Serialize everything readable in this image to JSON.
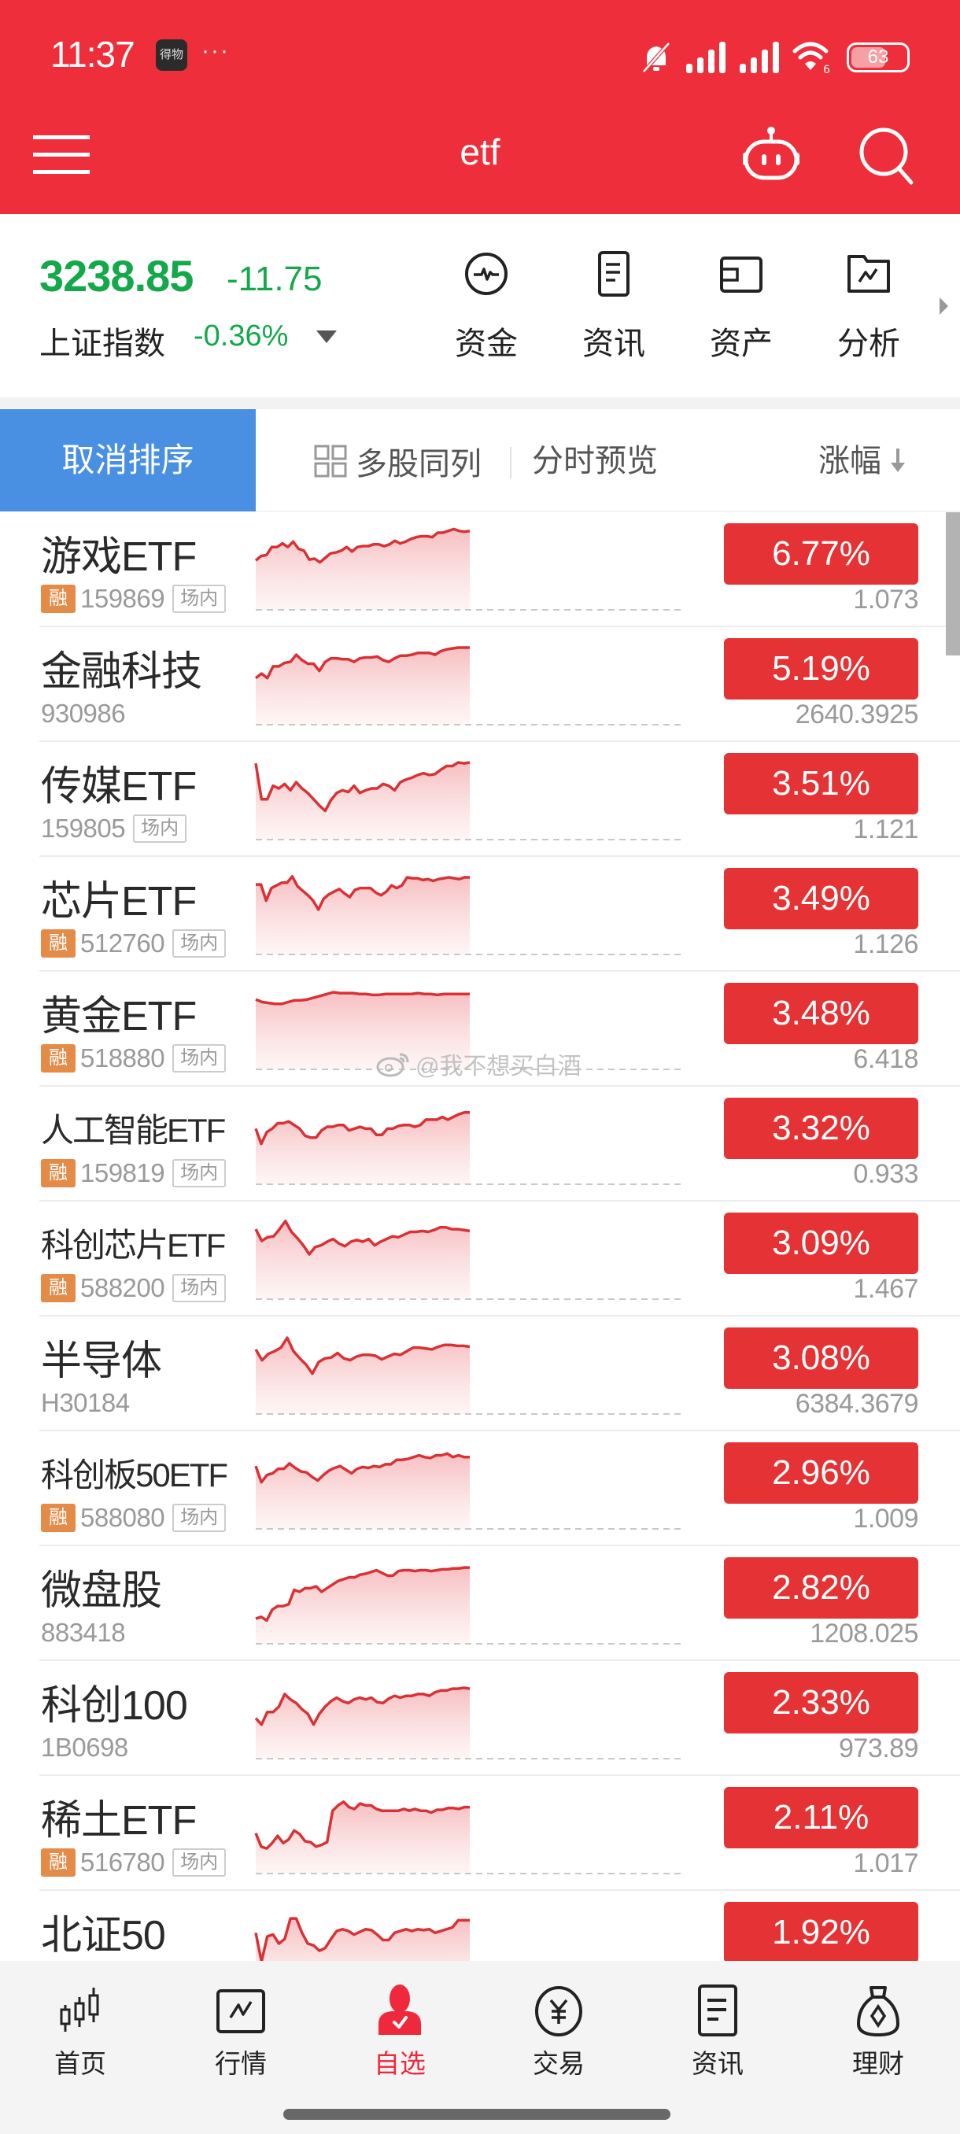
{
  "status_bar": {
    "time": "11:37",
    "app_badge": "得物",
    "overflow": "···",
    "battery": "63",
    "battery_level": 0.63,
    "wifi_sub": "6"
  },
  "header": {
    "title": "etf",
    "menu_icon": "hamburger-menu-icon",
    "assistant_icon": "robot-assistant-icon",
    "search_icon": "search-icon"
  },
  "index": {
    "price": "3238.85",
    "change": "-11.75",
    "name": "上证指数",
    "change_pct": "-0.36%",
    "color": "#14A84B"
  },
  "quick_links": [
    {
      "label": "资金",
      "icon": "pulse-circle-icon"
    },
    {
      "label": "资讯",
      "icon": "document-icon"
    },
    {
      "label": "资产",
      "icon": "wallet-icon"
    },
    {
      "label": "分析",
      "icon": "folder-chart-icon"
    }
  ],
  "toolbar": {
    "cancel_sort": "取消排序",
    "multi_stock": "多股同列",
    "preview": "分时预览",
    "sort_column": "涨幅"
  },
  "tags": {
    "margin": "融",
    "exchange": "场内"
  },
  "colors": {
    "brand_red": "#EE2E3A",
    "up_red": "#E53234",
    "down_green": "#14A84B",
    "active_blue": "#4A90E2",
    "margin_orange": "#E58B48"
  },
  "stocks": [
    {
      "name": "游戏ETF",
      "code": "159869",
      "margin": true,
      "exchange": true,
      "change_pct": "6.77%",
      "price": "1.073",
      "spark": [
        0.55,
        0.6,
        0.61,
        0.7,
        0.7,
        0.74,
        0.7,
        0.76,
        0.68,
        0.66,
        0.56,
        0.57,
        0.53,
        0.58,
        0.63,
        0.64,
        0.66,
        0.7,
        0.65,
        0.7,
        0.71,
        0.71,
        0.73,
        0.73,
        0.71,
        0.73,
        0.77,
        0.74,
        0.76,
        0.79,
        0.81,
        0.82,
        0.82,
        0.81,
        0.86,
        0.86,
        0.88,
        0.9,
        0.88,
        0.87,
        0.88
      ]
    },
    {
      "name": "金融科技",
      "code": "930986",
      "margin": false,
      "exchange": false,
      "change_pct": "5.19%",
      "price": "2640.3925",
      "spark": [
        0.52,
        0.57,
        0.52,
        0.65,
        0.65,
        0.69,
        0.7,
        0.78,
        0.72,
        0.68,
        0.68,
        0.6,
        0.7,
        0.74,
        0.74,
        0.73,
        0.73,
        0.7,
        0.74,
        0.75,
        0.75,
        0.76,
        0.72,
        0.7,
        0.74,
        0.77,
        0.77,
        0.78,
        0.8,
        0.8,
        0.8,
        0.78,
        0.82,
        0.84,
        0.85,
        0.86,
        0.86,
        0.86
      ]
    },
    {
      "name": "传媒ETF",
      "code": "159805",
      "margin": false,
      "exchange": true,
      "change_pct": "3.51%",
      "price": "1.121",
      "spark": [
        0.85,
        0.45,
        0.45,
        0.6,
        0.57,
        0.62,
        0.55,
        0.64,
        0.57,
        0.52,
        0.45,
        0.38,
        0.32,
        0.44,
        0.52,
        0.55,
        0.53,
        0.6,
        0.52,
        0.55,
        0.57,
        0.57,
        0.62,
        0.6,
        0.55,
        0.64,
        0.67,
        0.69,
        0.72,
        0.74,
        0.72,
        0.73,
        0.78,
        0.82,
        0.82,
        0.86,
        0.85,
        0.86
      ]
    },
    {
      "name": "芯片ETF",
      "code": "512760",
      "margin": true,
      "exchange": true,
      "change_pct": "3.49%",
      "price": "1.126",
      "spark": [
        0.78,
        0.78,
        0.6,
        0.74,
        0.77,
        0.8,
        0.8,
        0.87,
        0.76,
        0.71,
        0.66,
        0.6,
        0.5,
        0.62,
        0.67,
        0.7,
        0.73,
        0.68,
        0.64,
        0.72,
        0.74,
        0.74,
        0.74,
        0.69,
        0.66,
        0.7,
        0.77,
        0.74,
        0.77,
        0.86,
        0.85,
        0.85,
        0.83,
        0.84,
        0.82,
        0.84,
        0.85,
        0.86,
        0.85,
        0.84,
        0.86,
        0.86
      ]
    },
    {
      "name": "黄金ETF",
      "code": "518880",
      "margin": true,
      "exchange": true,
      "change_pct": "3.48%",
      "price": "6.418",
      "spark": [
        0.78,
        0.75,
        0.74,
        0.73,
        0.73,
        0.75,
        0.77,
        0.77,
        0.78,
        0.8,
        0.82,
        0.84,
        0.86,
        0.85,
        0.85,
        0.85,
        0.84,
        0.84,
        0.83,
        0.83,
        0.84,
        0.84,
        0.84,
        0.84,
        0.84,
        0.85,
        0.84,
        0.84,
        0.83,
        0.84,
        0.84,
        0.84,
        0.84,
        0.84
      ]
    },
    {
      "name": "人工智能ETF",
      "code": "159819",
      "margin": true,
      "exchange": true,
      "change_pct": "3.32%",
      "price": "0.933",
      "spark": [
        0.62,
        0.45,
        0.58,
        0.62,
        0.68,
        0.68,
        0.7,
        0.66,
        0.62,
        0.54,
        0.52,
        0.52,
        0.6,
        0.64,
        0.64,
        0.66,
        0.66,
        0.6,
        0.62,
        0.64,
        0.62,
        0.62,
        0.55,
        0.55,
        0.62,
        0.62,
        0.65,
        0.66,
        0.66,
        0.64,
        0.66,
        0.72,
        0.72,
        0.72,
        0.75,
        0.72,
        0.75,
        0.78,
        0.8,
        0.8
      ]
    },
    {
      "name": "科创芯片ETF",
      "code": "588200",
      "margin": true,
      "exchange": true,
      "change_pct": "3.09%",
      "price": "1.467",
      "spark": [
        0.78,
        0.65,
        0.69,
        0.7,
        0.78,
        0.87,
        0.75,
        0.68,
        0.6,
        0.5,
        0.58,
        0.6,
        0.64,
        0.67,
        0.62,
        0.59,
        0.64,
        0.66,
        0.64,
        0.67,
        0.6,
        0.64,
        0.67,
        0.7,
        0.69,
        0.72,
        0.75,
        0.75,
        0.76,
        0.75,
        0.77,
        0.8,
        0.8,
        0.78,
        0.78,
        0.77,
        0.76
      ]
    },
    {
      "name": "半导体",
      "code": "H30184",
      "margin": false,
      "exchange": false,
      "change_pct": "3.08%",
      "price": "6384.3679",
      "spark": [
        0.72,
        0.6,
        0.67,
        0.7,
        0.74,
        0.85,
        0.7,
        0.62,
        0.55,
        0.45,
        0.58,
        0.62,
        0.63,
        0.68,
        0.62,
        0.6,
        0.64,
        0.66,
        0.66,
        0.65,
        0.61,
        0.64,
        0.67,
        0.66,
        0.7,
        0.74,
        0.74,
        0.73,
        0.72,
        0.75,
        0.77,
        0.77,
        0.76,
        0.76,
        0.75
      ]
    },
    {
      "name": "科创板50ETF",
      "code": "588080",
      "margin": true,
      "exchange": true,
      "change_pct": "2.96%",
      "price": "1.009",
      "spark": [
        0.7,
        0.52,
        0.6,
        0.62,
        0.67,
        0.67,
        0.73,
        0.68,
        0.64,
        0.63,
        0.58,
        0.54,
        0.6,
        0.65,
        0.68,
        0.7,
        0.66,
        0.62,
        0.67,
        0.69,
        0.68,
        0.7,
        0.69,
        0.72,
        0.72,
        0.77,
        0.77,
        0.78,
        0.8,
        0.82,
        0.8,
        0.79,
        0.82,
        0.82,
        0.84,
        0.8,
        0.82,
        0.8,
        0.8
      ]
    },
    {
      "name": "微盘股",
      "code": "883418",
      "margin": false,
      "exchange": false,
      "change_pct": "2.82%",
      "price": "1208.025",
      "spark": [
        0.28,
        0.3,
        0.26,
        0.38,
        0.42,
        0.42,
        0.44,
        0.6,
        0.58,
        0.62,
        0.62,
        0.64,
        0.58,
        0.62,
        0.66,
        0.7,
        0.72,
        0.74,
        0.74,
        0.77,
        0.78,
        0.8,
        0.82,
        0.79,
        0.76,
        0.76,
        0.81,
        0.82,
        0.82,
        0.81,
        0.82,
        0.82,
        0.81,
        0.82,
        0.83,
        0.83,
        0.84,
        0.84,
        0.85,
        0.85
      ]
    },
    {
      "name": "科创100",
      "code": "1B0698",
      "margin": false,
      "exchange": false,
      "change_pct": "2.33%",
      "price": "973.89",
      "spark": [
        0.45,
        0.38,
        0.52,
        0.52,
        0.58,
        0.72,
        0.66,
        0.62,
        0.55,
        0.5,
        0.38,
        0.5,
        0.58,
        0.64,
        0.68,
        0.64,
        0.62,
        0.66,
        0.68,
        0.66,
        0.68,
        0.63,
        0.62,
        0.67,
        0.7,
        0.68,
        0.7,
        0.7,
        0.72,
        0.72,
        0.7,
        0.74,
        0.76,
        0.76,
        0.78,
        0.78,
        0.79,
        0.78
      ]
    },
    {
      "name": "稀土ETF",
      "code": "516780",
      "margin": true,
      "exchange": true,
      "change_pct": "2.11%",
      "price": "1.017",
      "spark": [
        0.45,
        0.3,
        0.28,
        0.34,
        0.42,
        0.34,
        0.38,
        0.48,
        0.44,
        0.36,
        0.35,
        0.3,
        0.32,
        0.35,
        0.7,
        0.76,
        0.8,
        0.74,
        0.72,
        0.78,
        0.76,
        0.76,
        0.72,
        0.7,
        0.7,
        0.7,
        0.7,
        0.72,
        0.7,
        0.72,
        0.7,
        0.7,
        0.68,
        0.71,
        0.71,
        0.73,
        0.73,
        0.72,
        0.74,
        0.74
      ]
    },
    {
      "name": "北证50",
      "code": "",
      "margin": false,
      "exchange": false,
      "change_pct": "1.92%",
      "price": "",
      "spark": [
        0.62,
        0.3,
        0.58,
        0.6,
        0.5,
        0.55,
        0.78,
        0.78,
        0.62,
        0.5,
        0.48,
        0.42,
        0.45,
        0.55,
        0.64,
        0.66,
        0.64,
        0.6,
        0.63,
        0.66,
        0.65,
        0.6,
        0.54,
        0.54,
        0.62,
        0.64,
        0.66,
        0.64,
        0.66,
        0.65,
        0.66,
        0.62,
        0.64,
        0.66,
        0.68,
        0.76,
        0.76,
        0.76
      ]
    }
  ],
  "watermark": "@我不想买白酒",
  "bottom_nav": [
    {
      "label": "首页",
      "icon": "candlestick-icon",
      "active": false
    },
    {
      "label": "行情",
      "icon": "market-chart-icon",
      "active": false
    },
    {
      "label": "自选",
      "icon": "watchlist-person-icon",
      "active": true
    },
    {
      "label": "交易",
      "icon": "yuan-coin-icon",
      "active": false
    },
    {
      "label": "资讯",
      "icon": "news-document-icon",
      "active": false
    },
    {
      "label": "理财",
      "icon": "money-bag-icon",
      "active": false
    }
  ]
}
